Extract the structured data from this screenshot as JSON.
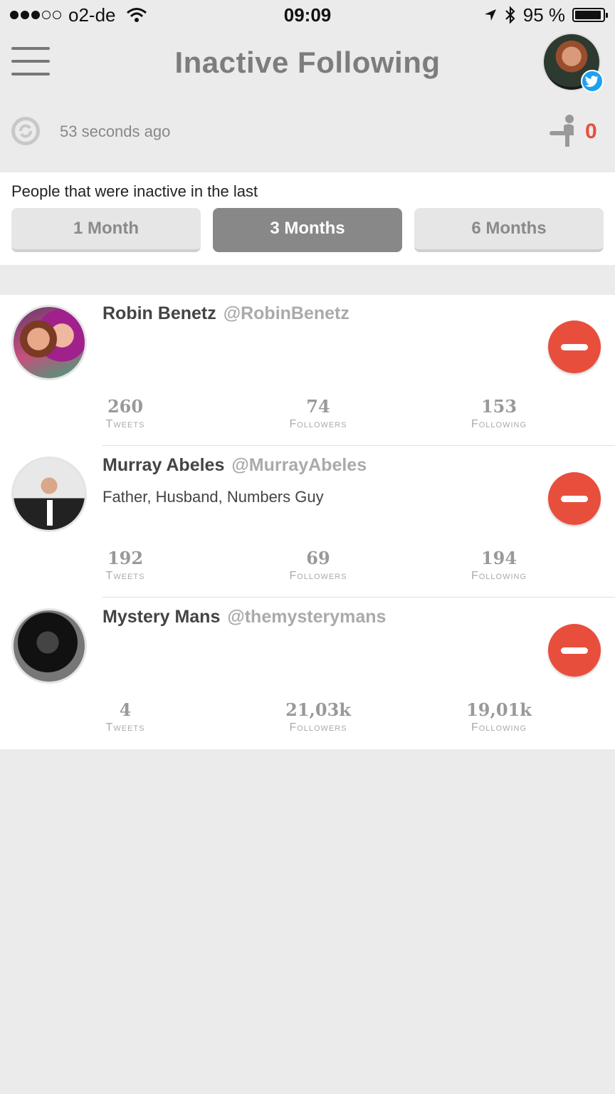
{
  "status_bar": {
    "carrier": "o2-de",
    "time": "09:09",
    "battery": "95 %",
    "battery_level": 0.95
  },
  "header": {
    "title": "Inactive Following",
    "menu_icon": "hamburger-menu-icon",
    "avatar_badge_icon": "twitter-bird-icon"
  },
  "sync": {
    "last_updated": "53 seconds ago",
    "unfollowed_count": "0",
    "count_color": "#e84e3c"
  },
  "filter": {
    "label": "People that were inactive in the last",
    "options": [
      "1 Month",
      "3 Months",
      "6 Months"
    ],
    "selected": "3 Months"
  },
  "users": [
    {
      "name": "Robin Benetz",
      "handle": "@RobinBenetz",
      "bio": "",
      "tweets": "260",
      "followers": "74",
      "following": "153"
    },
    {
      "name": "Murray Abeles",
      "handle": "@MurrayAbeles",
      "bio": "Father, Husband, Numbers Guy",
      "tweets": "192",
      "followers": "69",
      "following": "194"
    },
    {
      "name": "Mystery Mans",
      "handle": "@themysterymans",
      "bio": "",
      "tweets": "4",
      "followers": "21,03k",
      "following": "19,01k"
    }
  ],
  "stat_labels": {
    "tweets": "Tweets",
    "followers": "Followers",
    "following": "Following"
  },
  "colors": {
    "accent_red": "#e84e3c",
    "twitter_blue": "#1da1f2",
    "selected_filter": "#888888"
  }
}
